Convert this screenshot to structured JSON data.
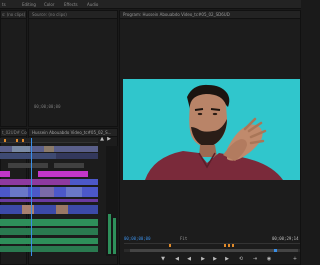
{
  "workspace_tabs": [
    {
      "label": "ts"
    },
    {
      "label": "Editing"
    },
    {
      "label": "Color"
    },
    {
      "label": "Effects"
    },
    {
      "label": "Audio"
    }
  ],
  "source_panel": {
    "left_tab": "s: (no clips)",
    "tab": "Source: (no clips)",
    "timecode": "00;00;00;00"
  },
  "program_panel": {
    "tab": "Program: Hussein Abouabdo Video_tc#05_02_SD6UD",
    "current_time": "00;00;00;00",
    "duration": "00;00;29;14",
    "fit": "Fit"
  },
  "timeline_panel": {
    "left_tab": "t_02UD# Copy 01",
    "sequence_tab": "Hussein Abouabdo Video_tc#05_02_S...",
    "timecode": "00;00;00;00"
  },
  "controls": {
    "mark_in": "▼",
    "step_back": "◀",
    "play": "▶",
    "step_fwd": "▶",
    "loop": "⟲",
    "export": "⇥",
    "camera": "◉",
    "settings": "+"
  },
  "colors": {
    "accent_blue": "#3a8ee6",
    "clip_magenta": "#c236c9",
    "clip_blue": "#4c58c9",
    "clip_green": "#2e8f5a",
    "video_bg": "#30c6cc",
    "marker_orange": "#e08a2a"
  }
}
